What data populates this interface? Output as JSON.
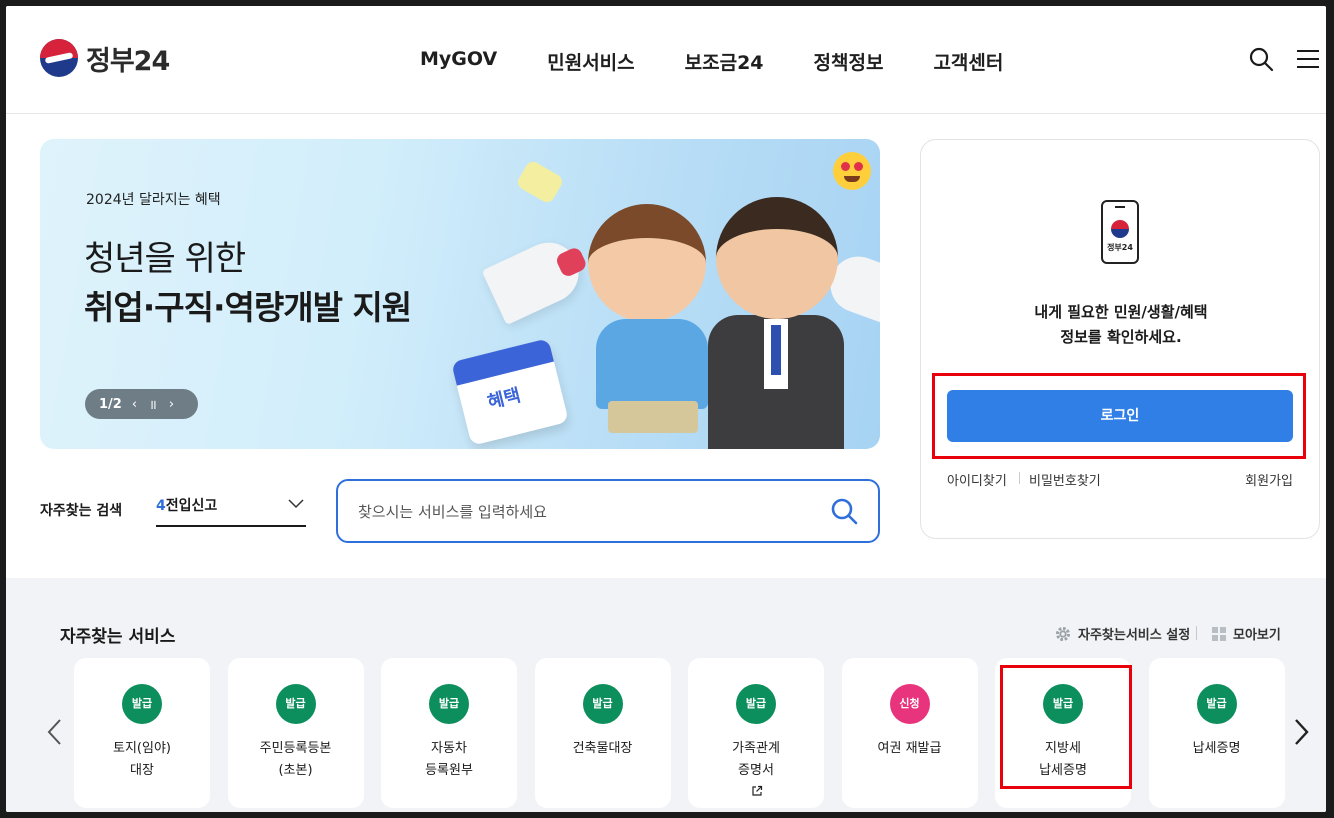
{
  "header": {
    "logo_text": "정부24",
    "nav": [
      "MyGOV",
      "민원서비스",
      "보조금24",
      "정책정보",
      "고객센터"
    ]
  },
  "banner": {
    "subtitle": "2024년 달라지는 혜택",
    "title_line1": "청년을 위한",
    "title_line2": "취업·구직·역량개발 지원",
    "calendar_label": "혜택",
    "pager": "1/2",
    "prev": "‹",
    "pause": "॥",
    "next": "›"
  },
  "quick_search": {
    "label": "자주찾는 검색",
    "selected_num": "4",
    "selected_text": "전입신고",
    "placeholder": "찾으시는 서비스를 입력하세요"
  },
  "login": {
    "phone_label": "정부24",
    "message_line1": "내게 필요한 민원/생활/혜택",
    "message_line2": "정보를 확인하세요.",
    "button": "로그인",
    "find_id": "아이디찾기",
    "find_pw": "비밀번호찾기",
    "signup": "회원가입"
  },
  "services": {
    "title": "자주찾는 서비스",
    "settings": "자주찾는서비스 설정",
    "view_all": "모아보기",
    "items": [
      {
        "badge": "발급",
        "line1": "토지(임야)",
        "line2": "대장",
        "badge_color": "#0c8f5c"
      },
      {
        "badge": "발급",
        "line1": "주민등록등본",
        "line2": "(초본)",
        "badge_color": "#0c8f5c"
      },
      {
        "badge": "발급",
        "line1": "자동차",
        "line2": "등록원부",
        "badge_color": "#0c8f5c"
      },
      {
        "badge": "발급",
        "line1": "건축물대장",
        "line2": "",
        "badge_color": "#0c8f5c"
      },
      {
        "badge": "발급",
        "line1": "가족관계",
        "line2": "증명서",
        "badge_color": "#0c8f5c"
      },
      {
        "badge": "신청",
        "line1": "여권 재발급",
        "line2": "",
        "badge_color": "#e8337d"
      },
      {
        "badge": "발급",
        "line1": "지방세",
        "line2": "납세증명",
        "badge_color": "#0c8f5c"
      },
      {
        "badge": "발급",
        "line1": "납세증명",
        "line2": "",
        "badge_color": "#0c8f5c"
      }
    ]
  },
  "colors": {
    "primary": "#2f7fe6",
    "highlight": "#e8000b",
    "issue_badge": "#0c8f5c",
    "apply_badge": "#e8337d"
  }
}
